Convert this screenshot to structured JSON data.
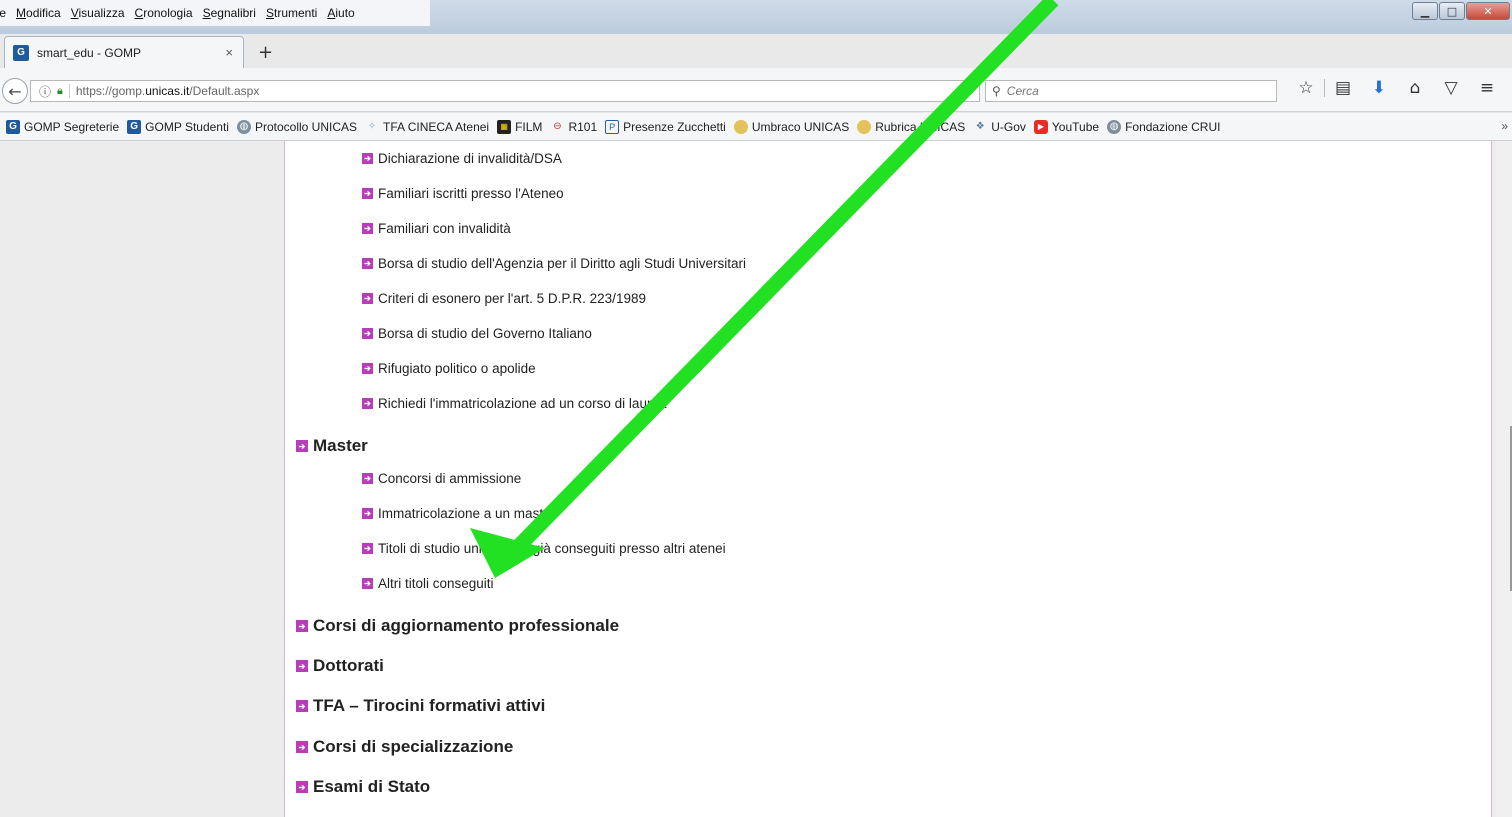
{
  "menubar": {
    "items": [
      "ile",
      "Modifica",
      "Visualizza",
      "Cronologia",
      "Segnalibri",
      "Strumenti",
      "Aiuto"
    ]
  },
  "tab": {
    "title": "smart_edu - GOMP",
    "close": "×",
    "new_tab": "+"
  },
  "nav": {
    "url_prefix": "https://gomp.",
    "url_domain": "unicas.it",
    "url_path": "/Default.aspx",
    "search_placeholder": "Cerca"
  },
  "bookmarks": [
    {
      "label": "GOMP Segreterie",
      "icon": "gomp-icon"
    },
    {
      "label": "GOMP Studenti",
      "icon": "gomp-icon"
    },
    {
      "label": "Protocollo UNICAS",
      "icon": "globe-icon"
    },
    {
      "label": "TFA CINECA Atenei",
      "icon": "tfa-icon"
    },
    {
      "label": "FILM",
      "icon": "film-icon"
    },
    {
      "label": "R101",
      "icon": "radio-icon"
    },
    {
      "label": "Presenze Zucchetti",
      "icon": "presenze-icon"
    },
    {
      "label": "Umbraco UNICAS",
      "icon": "umbraco-icon"
    },
    {
      "label": "Rubrica UNICAS",
      "icon": "umbraco-icon"
    },
    {
      "label": "U-Gov",
      "icon": "ugov-icon"
    },
    {
      "label": "YouTube",
      "icon": "youtube-icon"
    },
    {
      "label": "Fondazione CRUI",
      "icon": "globe-icon"
    }
  ],
  "page": {
    "sub_items_top": [
      "Dichiarazione di invalidità/DSA",
      "Familiari iscritti presso l'Ateneo",
      "Familiari con invalidità",
      "Borsa di studio dell'Agenzia per il Diritto agli Studi Universitari",
      "Criteri di esonero per l'art. 5 D.P.R. 223/1989",
      "Borsa di studio del Governo Italiano",
      "Rifugiato politico o apolide",
      "Richiedi l'immatricolazione ad un corso di laurea"
    ],
    "master_title": "Master",
    "master_items": [
      "Concorsi di ammissione",
      "Immatricolazione a un master",
      "Titoli di studio universitari già conseguiti presso altri atenei",
      "Altri titoli conseguiti"
    ],
    "sections": [
      "Corsi di aggiornamento professionale",
      "Dottorati",
      "TFA – Tirocini formativi attivi",
      "Corsi di specializzazione",
      "Esami di Stato"
    ]
  },
  "colors": {
    "bullet": "#b83db8",
    "arrow": "#22e022"
  }
}
